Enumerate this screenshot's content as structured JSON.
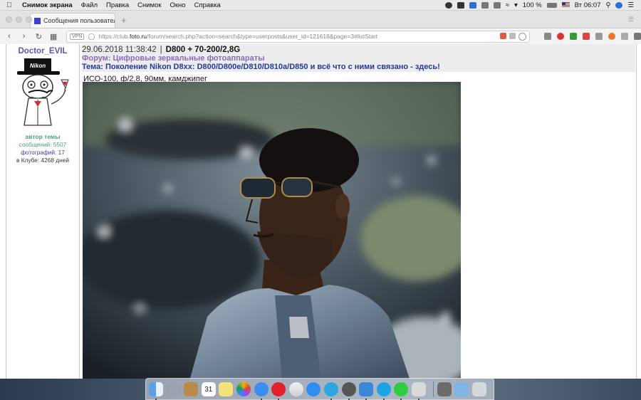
{
  "menubar": {
    "app_name": "Снимок экрана",
    "items": [
      "Файл",
      "Правка",
      "Снимок",
      "Окно",
      "Справка"
    ],
    "battery": "100 %",
    "clock": "Вт 06:07"
  },
  "browser": {
    "tab_title": "Сообщения пользовател",
    "vpn_label": "VPN",
    "url_prefix": "https://club.",
    "url_host": "foto.ru",
    "url_rest": "/forum/search.php?action=search&type=userposts&user_id=121618&page=3#listStart"
  },
  "sidebar": {
    "username": "Doctor_EVIL",
    "avatar_text": "Nikon",
    "author_label": "автор темы",
    "messages": "сообщений: 5507",
    "photos": "фотографий: 17",
    "club_days": "в Клубе: 4268 дней"
  },
  "post": {
    "datetime": "29.06.2018 11:38:42",
    "separator": "|",
    "subject": "D800 + 70-200/2,8G",
    "forum": "Форум: Цифровые зеркальные фотоаппараты",
    "topic": "Тема: Поколение Nikon D8xx: D800/D800e/D810/D810a/D850 и всё что с ними связано - здесь!",
    "exif": "ИСО-100, ф/2,8, 90мм, камджипег"
  },
  "dock": {
    "icons": [
      "finder-icon",
      "launchpad-icon",
      "notes-icon",
      "calendar-icon",
      "stickies-icon",
      "photos-icon",
      "messages-icon",
      "opera-icon",
      "itunes-icon",
      "app-store-icon",
      "telegram-icon",
      "screenshot-icon",
      "cloud-icon",
      "skype-icon",
      "whatsapp-icon",
      "preview-icon",
      "image-capture-icon",
      "downloads-folder-icon",
      "trash-icon"
    ],
    "calendar_day": "31"
  }
}
